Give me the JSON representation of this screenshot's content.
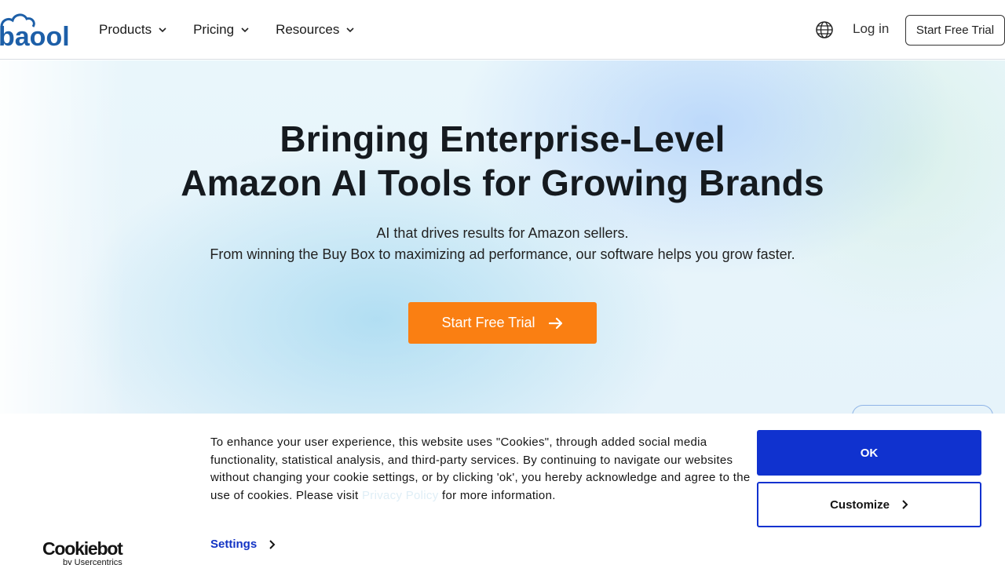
{
  "header": {
    "logo_text": "baool",
    "nav": [
      {
        "label": "Products"
      },
      {
        "label": "Pricing"
      },
      {
        "label": "Resources"
      }
    ],
    "login_label": "Log in",
    "trial_label": "Start Free Trial"
  },
  "hero": {
    "title_line1": "Bringing Enterprise-Level",
    "title_line2": "Amazon AI Tools for Growing Brands",
    "subtitle_line1": "AI that drives results for Amazon sellers.",
    "subtitle_line2": "From winning the Buy Box to maximizing ad performance, our software helps you grow faster.",
    "cta_label": "Start Free Trial"
  },
  "cookie": {
    "text_before": "To enhance your user experience, this website uses \"Cookies\", through added social media functionality, statistical analysis, and third-party services. By continuing to navigate our websites without changing your cookie settings, or by clicking 'ok', you hereby acknowledge and agree to the use of cookies. Please visit ",
    "link_label": "Privacy Policy",
    "text_after": " for more information.",
    "settings_label": "Settings",
    "ok_label": "OK",
    "customize_label": "Customize",
    "brand_name": "Cookiebot",
    "brand_by": "by Usercentrics"
  },
  "colors": {
    "accent_orange": "#fa7f12",
    "cookie_blue": "#1032cf",
    "logo_blue": "#1d5fa8"
  }
}
